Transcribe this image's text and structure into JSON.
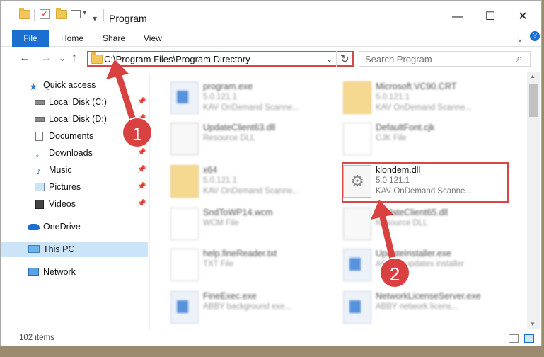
{
  "window": {
    "title": "Program",
    "minimize_glyph": "—",
    "maximize_glyph": "☐",
    "close_glyph": "✕"
  },
  "ribbon": {
    "tabs": [
      "File",
      "Home",
      "Share",
      "View"
    ],
    "expand_glyph": "⌄",
    "help_glyph": "?"
  },
  "nav": {
    "back_glyph": "←",
    "forward_glyph": "→",
    "recent_glyph": "⌄",
    "up_glyph": "↑",
    "address": "C:\\Program Files\\Program Directory",
    "dropdown_glyph": "⌄",
    "refresh_glyph": "↻",
    "search_placeholder": "Search Program",
    "search_glyph": "⌕"
  },
  "sidebar": {
    "items": [
      {
        "label": "Quick access",
        "icon": "star-icon",
        "pinned": false
      },
      {
        "label": "Local Disk (C:)",
        "icon": "drive-icon",
        "pinned": true
      },
      {
        "label": "Local Disk (D:)",
        "icon": "drive-icon",
        "pinned": true
      },
      {
        "label": "Documents",
        "icon": "documents-icon",
        "pinned": true
      },
      {
        "label": "Downloads",
        "icon": "download-icon",
        "pinned": true
      },
      {
        "label": "Music",
        "icon": "music-icon",
        "pinned": true
      },
      {
        "label": "Pictures",
        "icon": "pictures-icon",
        "pinned": true
      },
      {
        "label": "Videos",
        "icon": "videos-icon",
        "pinned": true
      },
      {
        "label": "OneDrive",
        "icon": "cloud-icon",
        "pinned": false
      },
      {
        "label": "This PC",
        "icon": "computer-icon",
        "pinned": false,
        "selected": true
      },
      {
        "label": "Network",
        "icon": "network-icon",
        "pinned": false
      }
    ],
    "pin_glyph": "📌"
  },
  "files": [
    {
      "name": "program.exe",
      "line2": "5.0.121.1",
      "line3": "KAV OnDemand Scanne...",
      "icon": "app-icon"
    },
    {
      "name": "Microsoft.VC90.CRT",
      "line2": "5.0.121.1",
      "line3": "KAV OnDemand Scanne...",
      "icon": "folder-icon"
    },
    {
      "name": "UpdateClient63.dll",
      "line2": "Resource DLL",
      "line3": "",
      "icon": "dll-icon"
    },
    {
      "name": "DefaultFont.cjk",
      "line2": "CJK File",
      "line3": "",
      "icon": "document-icon"
    },
    {
      "name": "x64",
      "line2": "5.0.121.1",
      "line3": "KAV OnDemand Scanne...",
      "icon": "folder-icon"
    },
    {
      "name": "klondem.dll",
      "line2": "5.0.121.1",
      "line3": "KAV OnDemand Scanne...",
      "icon": "dll-icon"
    },
    {
      "name": "SndToWP14.wcm",
      "line2": "WCM File",
      "line3": "",
      "icon": "document-icon"
    },
    {
      "name": "UpdateClient65.dll",
      "line2": "Resource DLL",
      "line3": "",
      "icon": "dll-icon"
    },
    {
      "name": "help.fineReader.txt",
      "line2": "TXT File",
      "line3": "",
      "icon": "document-icon"
    },
    {
      "name": "UpdateInstaller.exe",
      "line2": "ABBYY updates installer",
      "line3": "",
      "icon": "app-icon"
    },
    {
      "name": "FineExec.exe",
      "line2": "ABBY background exe...",
      "line3": "",
      "icon": "app-icon"
    },
    {
      "name": "NetworkLicenseServer.exe",
      "line2": "ABBY network licens...",
      "line3": "",
      "icon": "app-icon"
    }
  ],
  "status": {
    "item_count": "102 items"
  },
  "annotations": {
    "badge1": "1",
    "badge2": "2"
  },
  "colors": {
    "accent": "#1a6fd0",
    "highlight_red": "#d64848",
    "badge_red": "#d94141"
  }
}
